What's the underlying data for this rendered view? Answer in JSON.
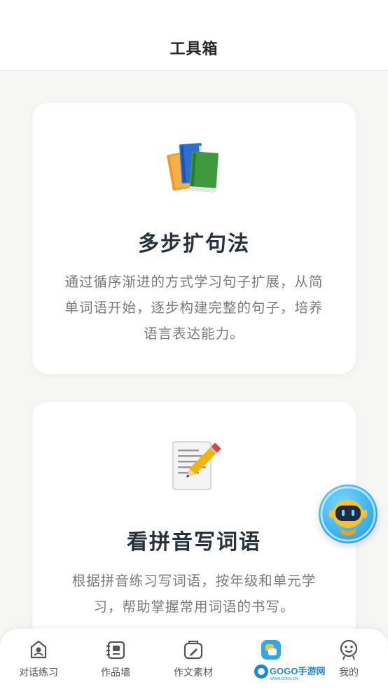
{
  "header": {
    "title": "工具箱"
  },
  "cards": [
    {
      "icon": "books-icon",
      "title": "多步扩句法",
      "desc_lines": [
        "通过循序渐进的方式学习句子扩展，从简",
        "单词语开始，逐步构建完整的句子，培养",
        "语言表达能力。"
      ]
    },
    {
      "icon": "memo-pencil-icon",
      "title": "看拼音写词语",
      "desc_lines": [
        "根据拼音练习写词语，按年级和单元学",
        "习，帮助掌握常用词语的书写。"
      ]
    }
  ],
  "floating_button": {
    "icon": "robot-assistant-icon"
  },
  "tabbar": {
    "tabs": [
      {
        "label": "对话练习",
        "icon": "chat-practice-icon"
      },
      {
        "label": "作品墙",
        "icon": "works-wall-icon"
      },
      {
        "label": "作文素材",
        "icon": "composition-material-icon"
      },
      {
        "label": "",
        "icon": "toolbox-icon",
        "active": true
      },
      {
        "label": "我的",
        "icon": "profile-face-icon"
      }
    ]
  },
  "watermark": {
    "text": "GOGO手游网",
    "subtext": "WWW.GOGO.CN"
  },
  "colors": {
    "accent": "#2fa8e8",
    "title": "#27313d",
    "desc": "#7b7b7b",
    "background": "#f6f6f4"
  }
}
